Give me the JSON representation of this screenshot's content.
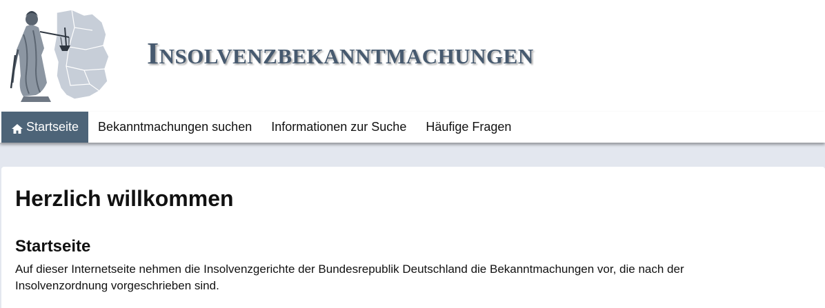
{
  "header": {
    "logo_icon": "justitia-germany-map-logo",
    "site_title": "Insolvenzbekanntmachungen",
    "title_color": "#475a6f"
  },
  "nav": {
    "items": [
      {
        "label": "Startseite",
        "icon": "home-icon",
        "active": true
      },
      {
        "label": "Bekanntmachungen suchen",
        "active": false
      },
      {
        "label": "Informationen zur Suche",
        "active": false
      },
      {
        "label": "Häufige Fragen",
        "active": false
      }
    ],
    "active_color": "#4d6478"
  },
  "main": {
    "title": "Herzlich willkommen",
    "section_title": "Startseite",
    "intro_text": "Auf dieser Internetseite nehmen die Insolvenzgerichte der Bundesrepublik Deutschland die Bekanntmachungen vor, die nach der Insolvenzordnung vorgeschrieben sind."
  }
}
